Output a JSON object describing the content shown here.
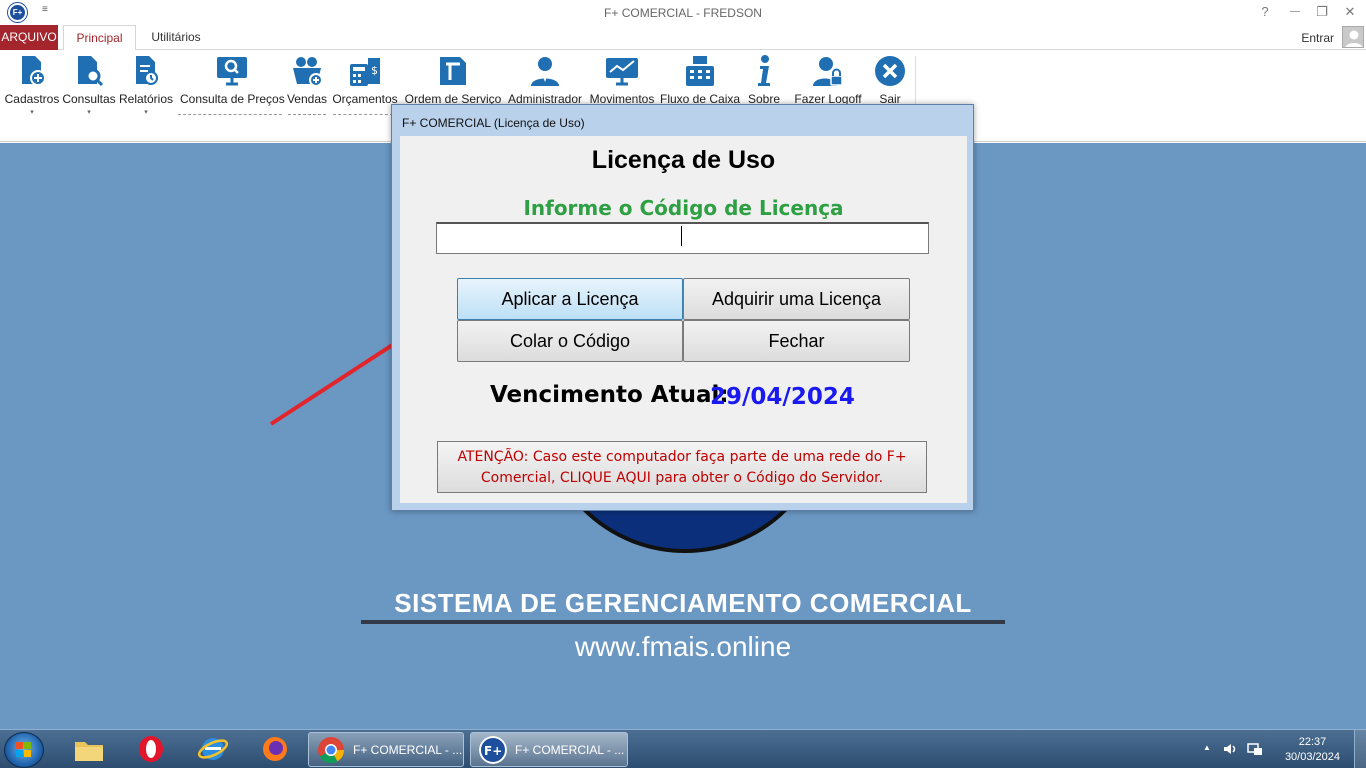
{
  "window": {
    "title": "F+ COMERCIAL - FREDSON",
    "logo_text": "F+",
    "qat_glyph": "≡",
    "help_glyph": "?",
    "minimize_glyph": "—",
    "restore_glyph": "❐",
    "close_glyph": "✕"
  },
  "tabs": {
    "arquivo": "ARQUIVO",
    "principal": "Principal",
    "utilitarios": "Utilitários",
    "entrar": "Entrar"
  },
  "ribbon": {
    "items": [
      {
        "label": "Cadastros",
        "icon": "add-document-icon",
        "has_dropdown": true
      },
      {
        "label": "Consultas",
        "icon": "search-document-icon",
        "has_dropdown": true
      },
      {
        "label": "Relatórios",
        "icon": "report-icon",
        "has_dropdown": true
      },
      {
        "label": "Consulta de Preços",
        "icon": "monitor-search-icon"
      },
      {
        "label": "Vendas",
        "icon": "basket-icon"
      },
      {
        "label": "Orçamentos",
        "icon": "calculator-icon"
      },
      {
        "label": "Ordem de Serviço",
        "icon": "service-order-icon"
      },
      {
        "label": "Administrador",
        "icon": "admin-user-icon"
      },
      {
        "label": "Movimentos",
        "icon": "chart-monitor-icon"
      },
      {
        "label": "Fluxo de Caixa",
        "icon": "cash-register-icon"
      },
      {
        "label": "Sobre",
        "icon": "info-icon"
      },
      {
        "label": "Fazer Logoff",
        "icon": "logoff-user-icon"
      },
      {
        "label": "Sair",
        "icon": "exit-icon"
      }
    ],
    "dropdown_glyph": "▾",
    "collapse_glyph": "▲"
  },
  "background": {
    "system_title": "SISTEMA DE GERENCIAMENTO COMERCIAL",
    "url": "www.fmais.online"
  },
  "dialog": {
    "title": "F+ COMERCIAL (Licença de Uso)",
    "heading": "Licença de Uso",
    "subheading": "Informe o Código de Licença",
    "code_value": "",
    "buttons": {
      "apply": "Aplicar a Licença",
      "acquire": "Adquirir uma Licença",
      "paste": "Colar o Código",
      "close": "Fechar"
    },
    "expiry_label": "Vencimento Atual:",
    "expiry_date": "29/04/2024",
    "attention_line1": "ATENÇÃO: Caso este computador faça parte de uma rede do F+",
    "attention_line2": "Comercial, CLIQUE AQUI para obter o Código do Servidor."
  },
  "taskbar": {
    "pinned": [
      "file-explorer-icon",
      "opera-icon",
      "internet-explorer-icon",
      "firefox-icon"
    ],
    "tasks": [
      {
        "label": "F+ COMERCIAL - ...",
        "icon": "chrome-icon"
      },
      {
        "label": "F+ COMERCIAL - ...",
        "icon": "fplus-app-icon"
      }
    ],
    "tray_expand": "▲",
    "clock_time": "22:37",
    "clock_date": "30/03/2024"
  },
  "colors": {
    "accent": "#a4262c",
    "background_blue": "#6b97c3",
    "subheading_green": "#2ea043",
    "date_blue": "#1a1af0",
    "attention_red": "#c00000"
  }
}
